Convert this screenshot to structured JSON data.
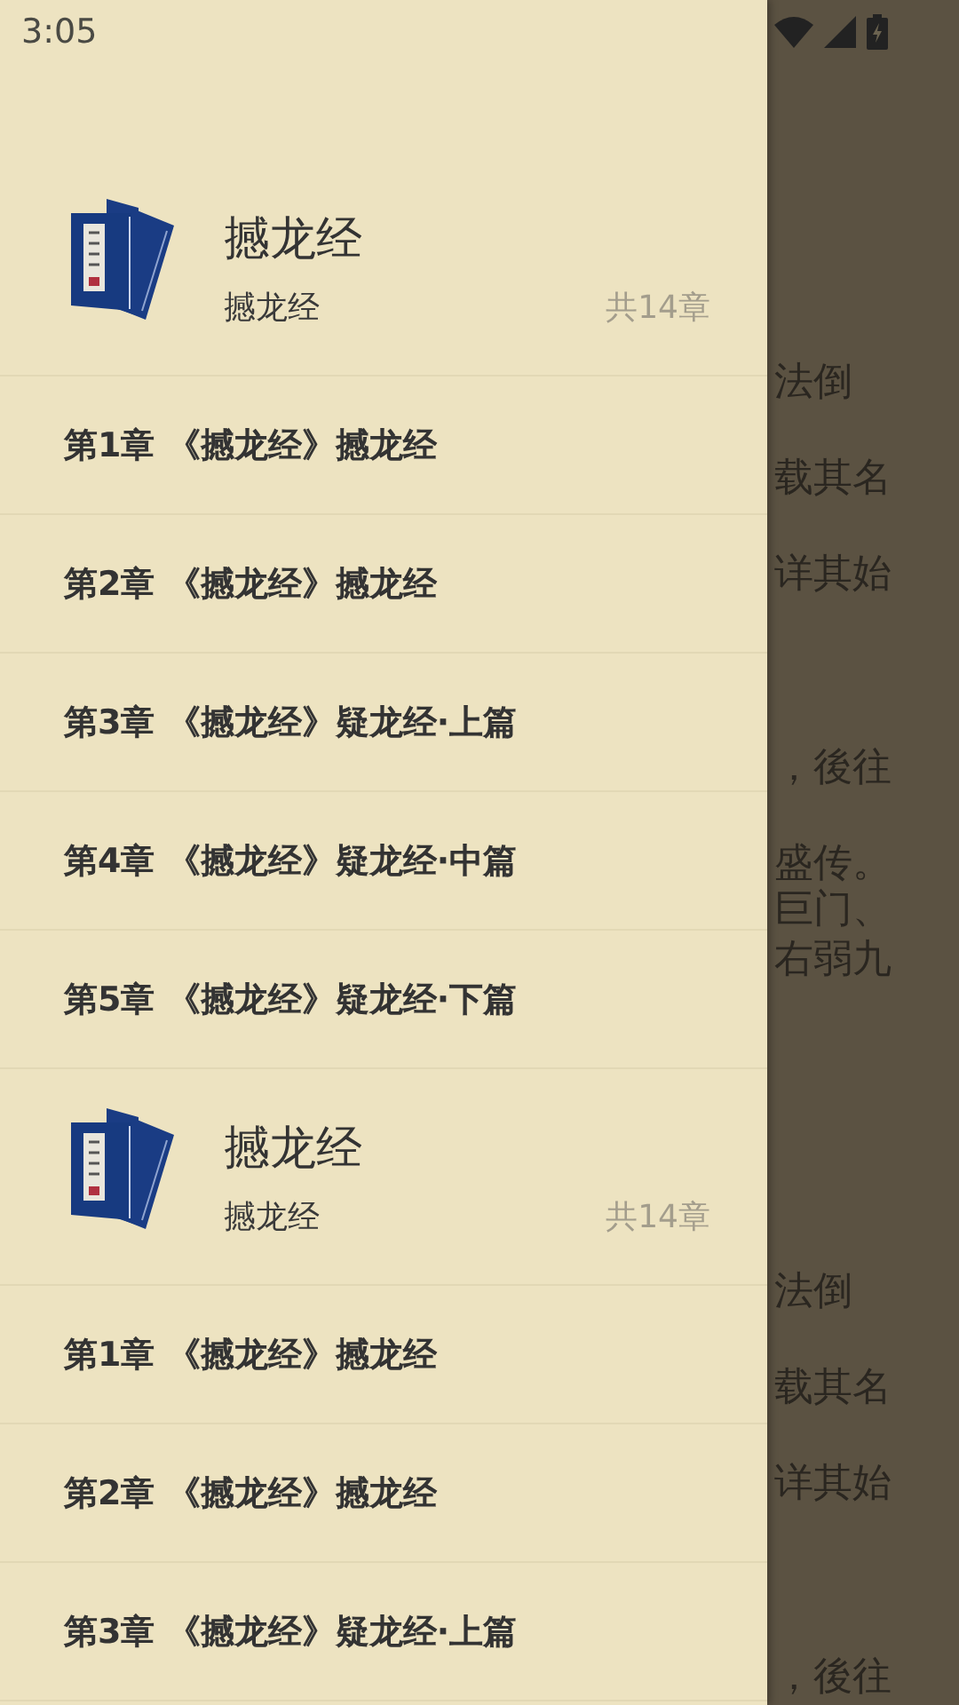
{
  "status_bar": {
    "time": "3:05"
  },
  "drawer_copies": [
    {
      "book": {
        "title": "撼龙经",
        "subtitle": "撼龙经",
        "chapter_count": "共14章"
      },
      "chapters": [
        {
          "label": "第1章 《撼龙经》撼龙经"
        },
        {
          "label": "第2章 《撼龙经》撼龙经"
        },
        {
          "label": "第3章 《撼龙经》疑龙经·上篇"
        },
        {
          "label": "第4章 《撼龙经》疑龙经·中篇"
        },
        {
          "label": "第5章 《撼龙经》疑龙经·下篇"
        }
      ]
    },
    {
      "book": {
        "title": "撼龙经",
        "subtitle": "撼龙经",
        "chapter_count": "共14章"
      },
      "chapters": [
        {
          "label": "第1章 《撼龙经》撼龙经"
        },
        {
          "label": "第2章 《撼龙经》撼龙经"
        },
        {
          "label": "第3章 《撼龙经》疑龙经·上篇"
        }
      ]
    }
  ],
  "reader_pages": [
    {
      "lines": [
        "法倒",
        "载其名",
        "详其始",
        "，後往",
        "盛传。",
        "巨门、",
        "右弱九"
      ]
    },
    {
      "lines": [
        "法倒",
        "载其名",
        "详其始",
        "，後往"
      ]
    }
  ]
}
